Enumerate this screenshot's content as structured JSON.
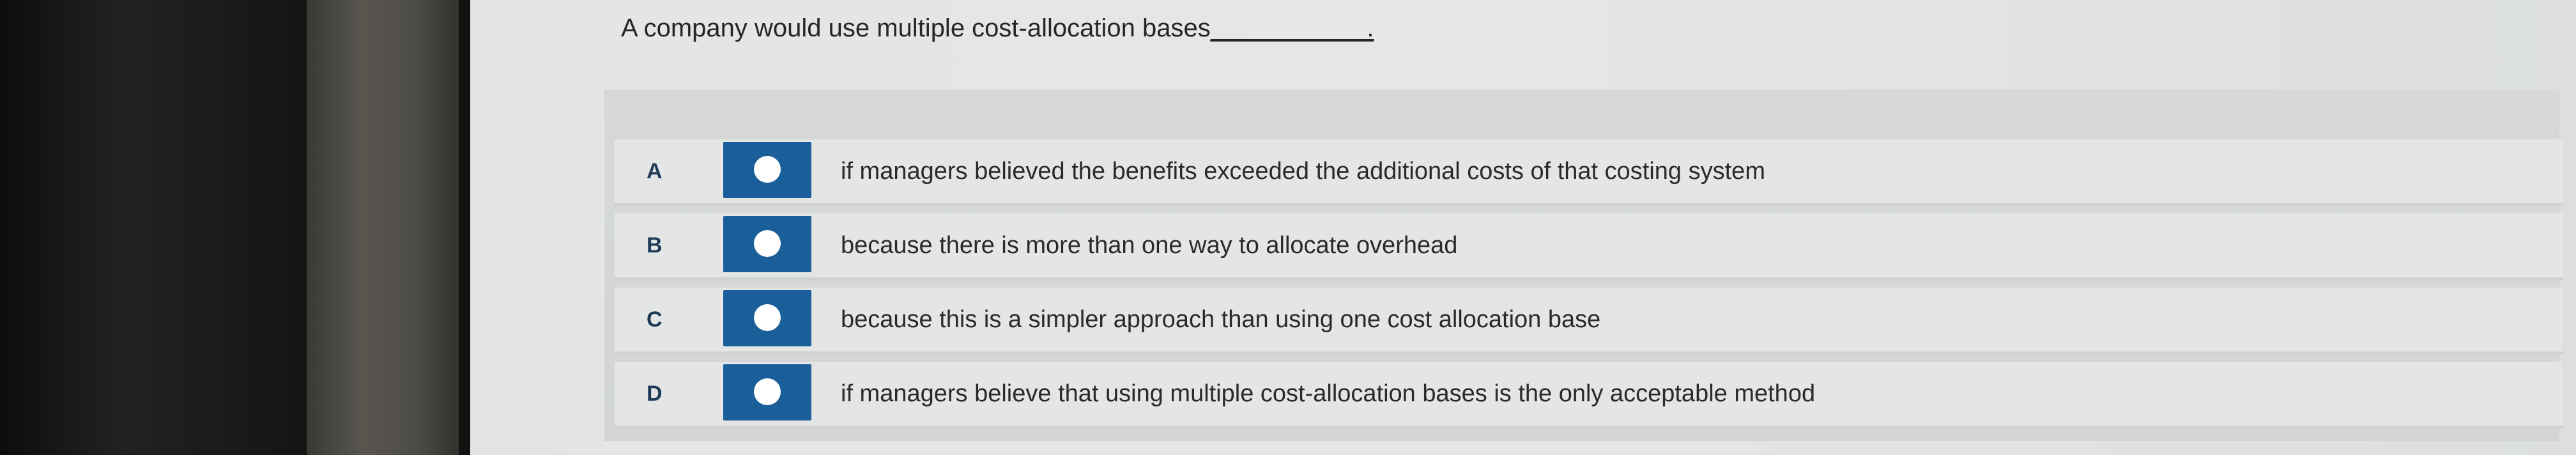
{
  "question": {
    "text": "A company would use multiple cost-allocation bases",
    "blank": "___________."
  },
  "options": [
    {
      "letter": "A",
      "text": "if managers believed the benefits exceeded the additional costs of that costing system"
    },
    {
      "letter": "B",
      "text": "because there is more than one way to allocate overhead"
    },
    {
      "letter": "C",
      "text": "because this is a simpler approach than using one cost allocation base"
    },
    {
      "letter": "D",
      "text": "if managers believe that using multiple cost-allocation bases is the only acceptable method"
    }
  ],
  "colors": {
    "radio": "#1a5f99",
    "radio_dot": "#ffffff",
    "letter": "#1f3a57"
  }
}
